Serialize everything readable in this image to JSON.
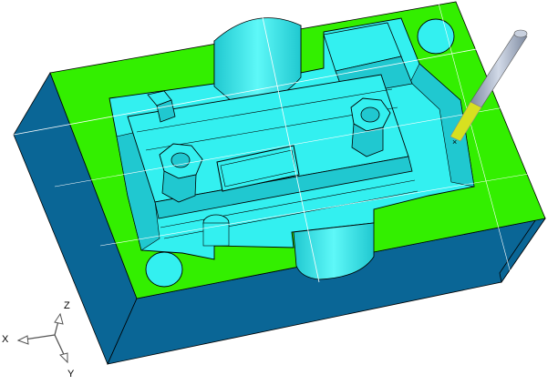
{
  "viewport": {
    "background": "#ffffff"
  },
  "colors": {
    "block_side": "#0a6696",
    "block_face": "#33ef00",
    "cavity": "#33f0f0",
    "cavity_shade": "#20c8d0",
    "edge": "#000000",
    "section_line": "#ffffff",
    "tool_shank": "#a9b4c6",
    "tool_tip": "#d8e020"
  },
  "triad": {
    "x_label": "X",
    "y_label": "Y",
    "z_label": "Z"
  }
}
